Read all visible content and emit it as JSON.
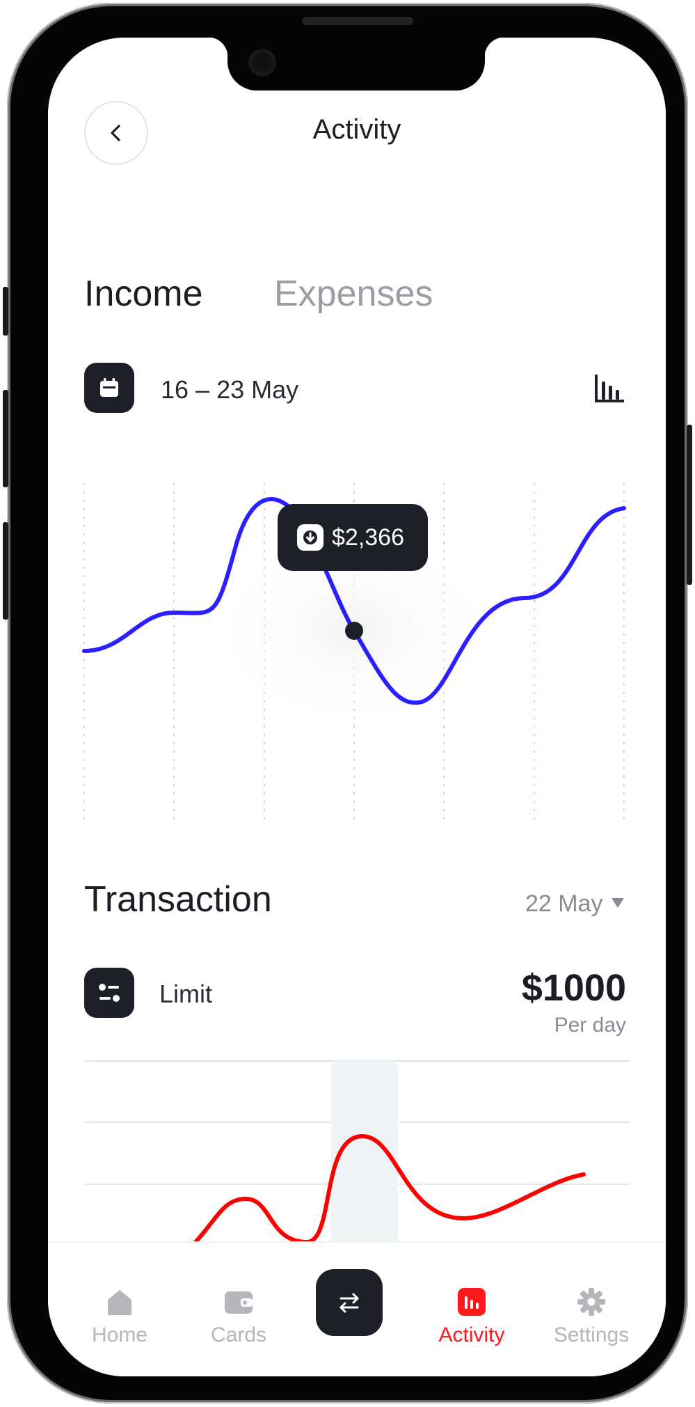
{
  "header": {
    "title": "Activity",
    "back_icon": "chevron-left-icon"
  },
  "tabs": [
    {
      "label": "Income",
      "active": true
    },
    {
      "label": "Expenses",
      "active": false
    }
  ],
  "date_range": {
    "label": "16 – 23 May",
    "icon": "calendar-icon",
    "view_icon": "bar-chart-icon"
  },
  "income_chart": {
    "tooltip_value": "$2,366",
    "tooltip_icon": "arrow-down-icon",
    "line_color": "#2b1fff"
  },
  "transaction": {
    "title": "Transaction",
    "date_filter": "22 May",
    "limit_label": "Limit",
    "limit_value": "$1000",
    "limit_period": "Per day",
    "line_color": "#ff0000"
  },
  "nav": {
    "items": [
      {
        "label": "Home",
        "icon": "home-icon",
        "active": false
      },
      {
        "label": "Cards",
        "icon": "wallet-icon",
        "active": false
      },
      {
        "label": "Activity",
        "icon": "activity-chart-icon",
        "active": true
      },
      {
        "label": "Settings",
        "icon": "gear-icon",
        "active": false
      }
    ],
    "center_icon": "transfer-arrows-icon"
  },
  "colors": {
    "accent": "#ff1a1a",
    "dark": "#1e2029",
    "muted": "#9b9ca5"
  }
}
